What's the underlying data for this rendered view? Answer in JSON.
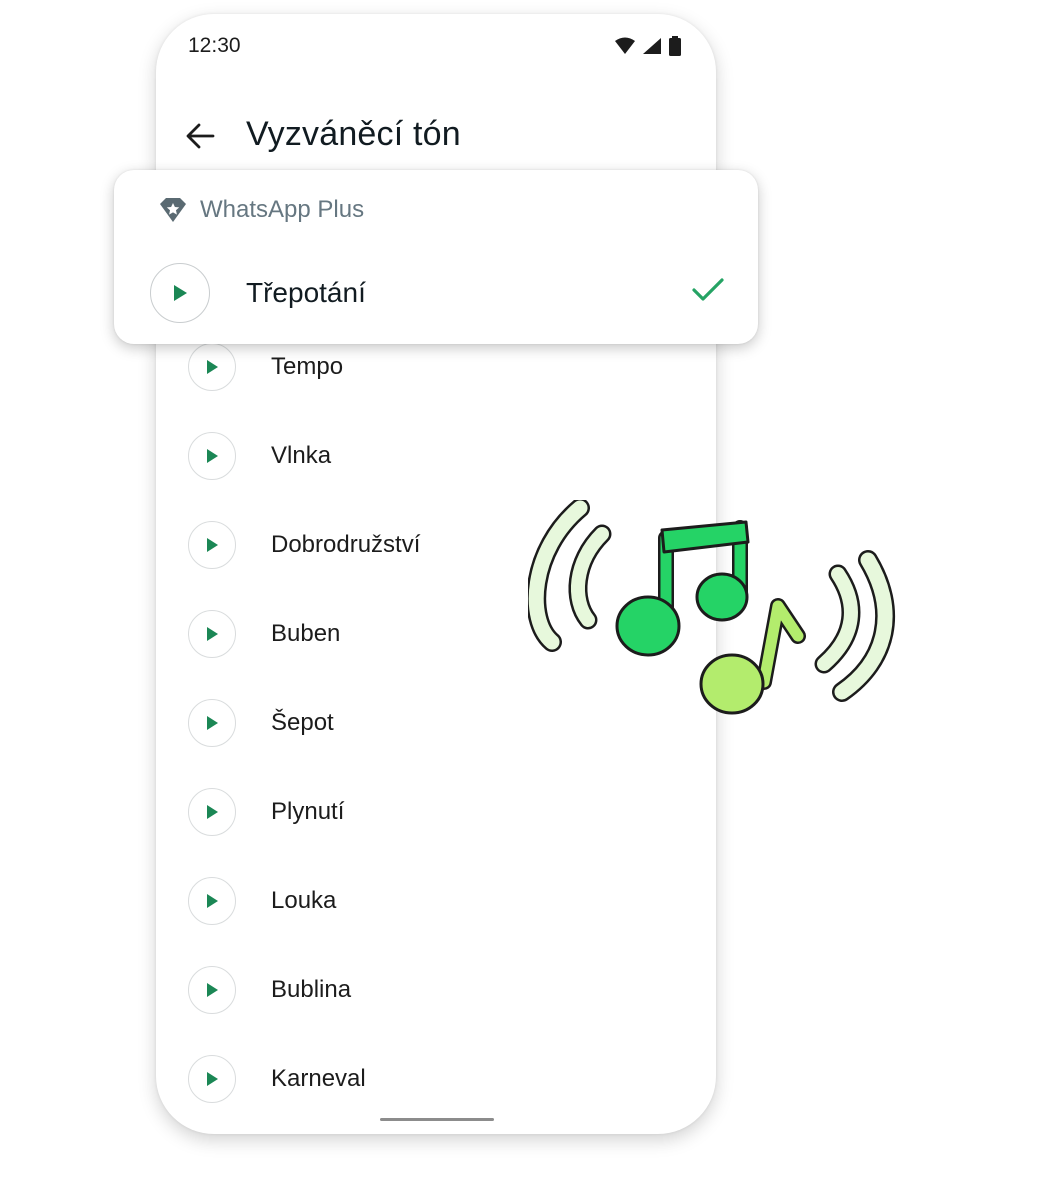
{
  "status_bar": {
    "time": "12:30",
    "icons": [
      "wifi-icon",
      "signal-icon",
      "battery-icon"
    ]
  },
  "header": {
    "title": "Vyzváněcí tón",
    "back_icon": "arrow-left-icon"
  },
  "plus_section": {
    "label": "WhatsApp Plus",
    "icon": "premium-badge-icon",
    "selected_tone": "Třepotání",
    "selected_icon": "check-icon"
  },
  "tones": [
    {
      "label": "Tempo"
    },
    {
      "label": "Vlnka"
    },
    {
      "label": "Dobrodružství"
    },
    {
      "label": "Buben"
    },
    {
      "label": "Šepot"
    },
    {
      "label": "Plynutí"
    },
    {
      "label": "Louka"
    },
    {
      "label": "Bublina"
    },
    {
      "label": "Karneval"
    }
  ],
  "colors": {
    "accent": "#1b8755",
    "check": "#25a364",
    "note_dark": "#25d366",
    "note_light": "#b3ec6d",
    "waves": "#e7f8dc"
  }
}
